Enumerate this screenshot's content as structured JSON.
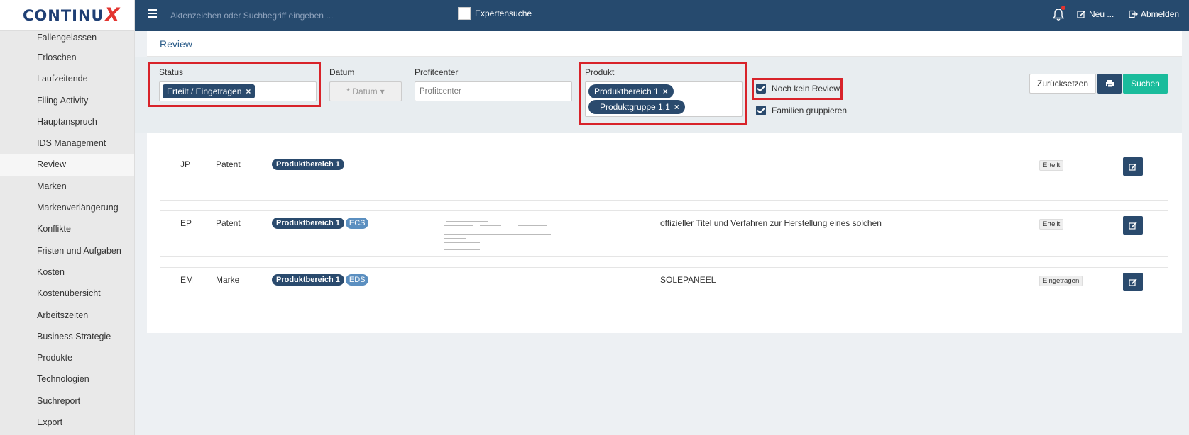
{
  "app": {
    "logo": "CONTINU",
    "logo_x": "X"
  },
  "sidebar": {
    "items": [
      "Fallengelassen",
      "Erloschen",
      "Laufzeitende",
      "Filing Activity",
      "Hauptanspruch",
      "IDS Management",
      "Review",
      "Marken",
      "Markenverlängerung",
      "Konflikte",
      "Fristen und Aufgaben",
      "Kosten",
      "Kostenübersicht",
      "Arbeitszeiten",
      "Business Strategie",
      "Produkte",
      "Technologien",
      "Suchreport",
      "Export"
    ],
    "active": "Review"
  },
  "topbar": {
    "search_placeholder": "Aktenzeichen oder Suchbegriff eingeben ...",
    "expert_label": "Expertensuche",
    "new_label": "Neu ...",
    "logout_label": "Abmelden"
  },
  "page": {
    "title": "Review"
  },
  "filters": {
    "status_label": "Status",
    "status_tag": "Erteilt / Eingetragen",
    "date_label": "Datum",
    "date_button": "* Datum",
    "profit_label": "Profitcenter",
    "profit_placeholder": "Profitcenter",
    "product_label": "Produkt",
    "product_tags": [
      "Produktbereich 1",
      "Produktgruppe 1.1"
    ],
    "no_review_label": "Noch kein Review",
    "group_families_label": "Familien gruppieren",
    "reset_label": "Zurücksetzen",
    "search_label": "Suchen"
  },
  "results": [
    {
      "country": "JP",
      "type": "Patent",
      "product": "Produktbereich 1",
      "extra": "",
      "title": "",
      "status": "Erteilt",
      "has_thumb": false
    },
    {
      "country": "EP",
      "type": "Patent",
      "product": "Produktbereich 1",
      "extra": "ECS",
      "title": "offizieller Titel und Verfahren zur Herstellung eines solchen",
      "status": "Erteilt",
      "has_thumb": true
    },
    {
      "country": "EM",
      "type": "Marke",
      "product": "Produktbereich 1",
      "extra": "EDS",
      "title": "SOLEPANEEL",
      "status": "Eingetragen",
      "has_thumb": false
    }
  ]
}
